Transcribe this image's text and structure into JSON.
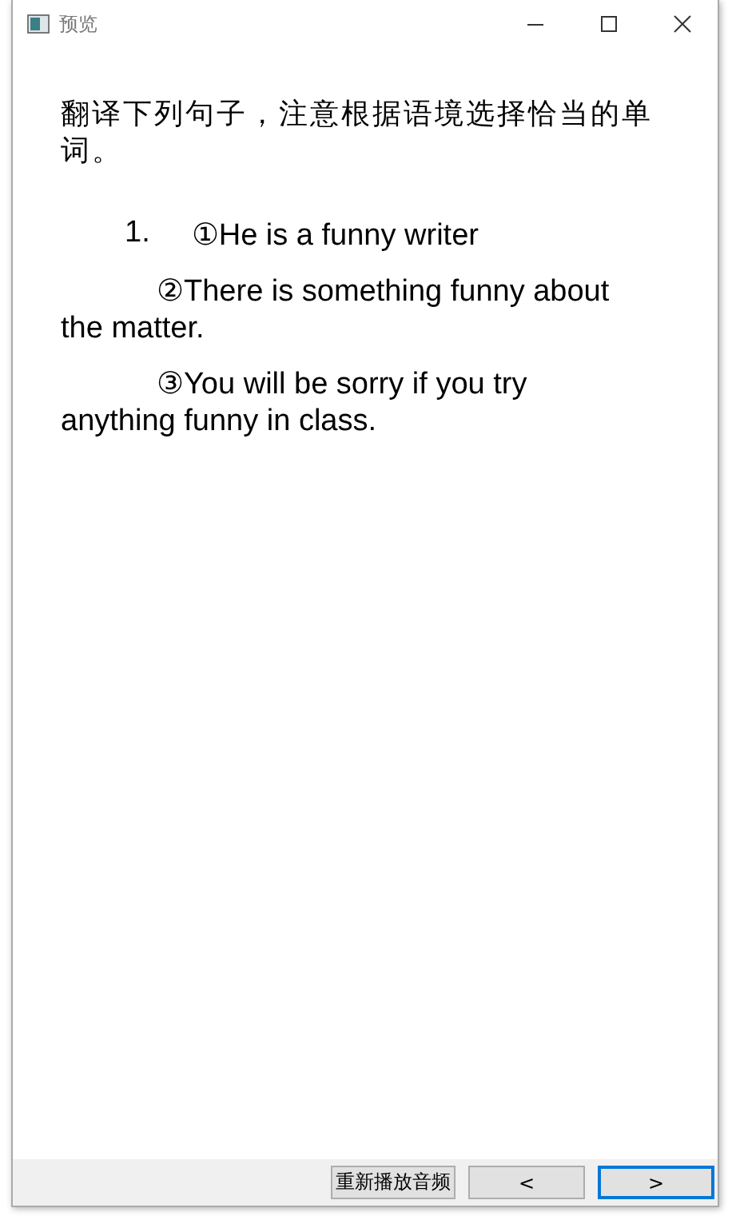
{
  "window": {
    "title": "预览"
  },
  "question": "翻译下列句子，注意根据语境选择恰当的单词。",
  "items": [
    {
      "number": "1.",
      "lines": [
        "①He is a funny writer",
        "②There is something funny about the matter.",
        "③You will be sorry if you try anything funny in class."
      ]
    }
  ],
  "buttons": [
    {
      "label": "重新播放音频",
      "kind": "replay",
      "focused": false
    },
    {
      "label": "<",
      "kind": "prev",
      "focused": false
    },
    {
      "label": ">",
      "kind": "next",
      "focused": true
    }
  ]
}
